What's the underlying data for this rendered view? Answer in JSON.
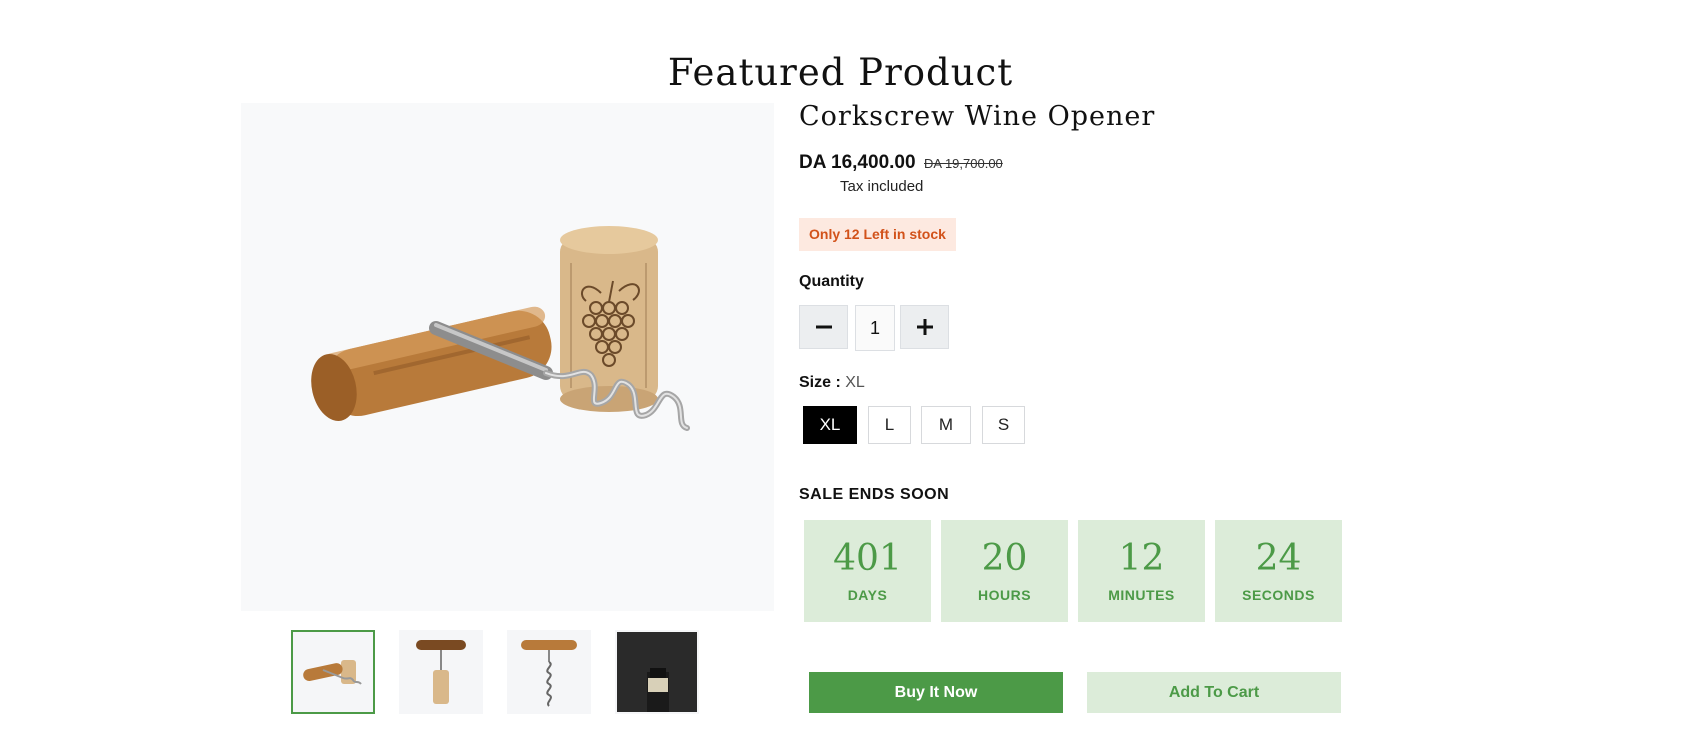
{
  "section": {
    "title": "Featured Product"
  },
  "product": {
    "title": "Corkscrew Wine Opener",
    "price": "DA 16,400.00",
    "compare_price": "DA 19,700.00",
    "tax_note": "Tax included",
    "stock_badge": "Only 12 Left in stock"
  },
  "quantity": {
    "label": "Quantity",
    "minus_icon": "minus-icon",
    "plus_icon": "plus-icon",
    "value": "1"
  },
  "size": {
    "label": "Size :",
    "selected": "XL",
    "options": [
      "XL",
      "L",
      "M",
      "S"
    ]
  },
  "countdown": {
    "title": "SALE ENDS SOON",
    "items": [
      {
        "value": "401",
        "unit": "DAYS"
      },
      {
        "value": "20",
        "unit": "HOURS"
      },
      {
        "value": "12",
        "unit": "MINUTES"
      },
      {
        "value": "24",
        "unit": "SECONDS"
      }
    ]
  },
  "actions": {
    "buy_now": "Buy It Now",
    "add_to_cart": "Add To Cart"
  },
  "colors": {
    "accent_green": "#4c9a47",
    "light_green": "#dcecd9",
    "stock_text": "#d2521a",
    "stock_bg": "#fde9e0"
  }
}
